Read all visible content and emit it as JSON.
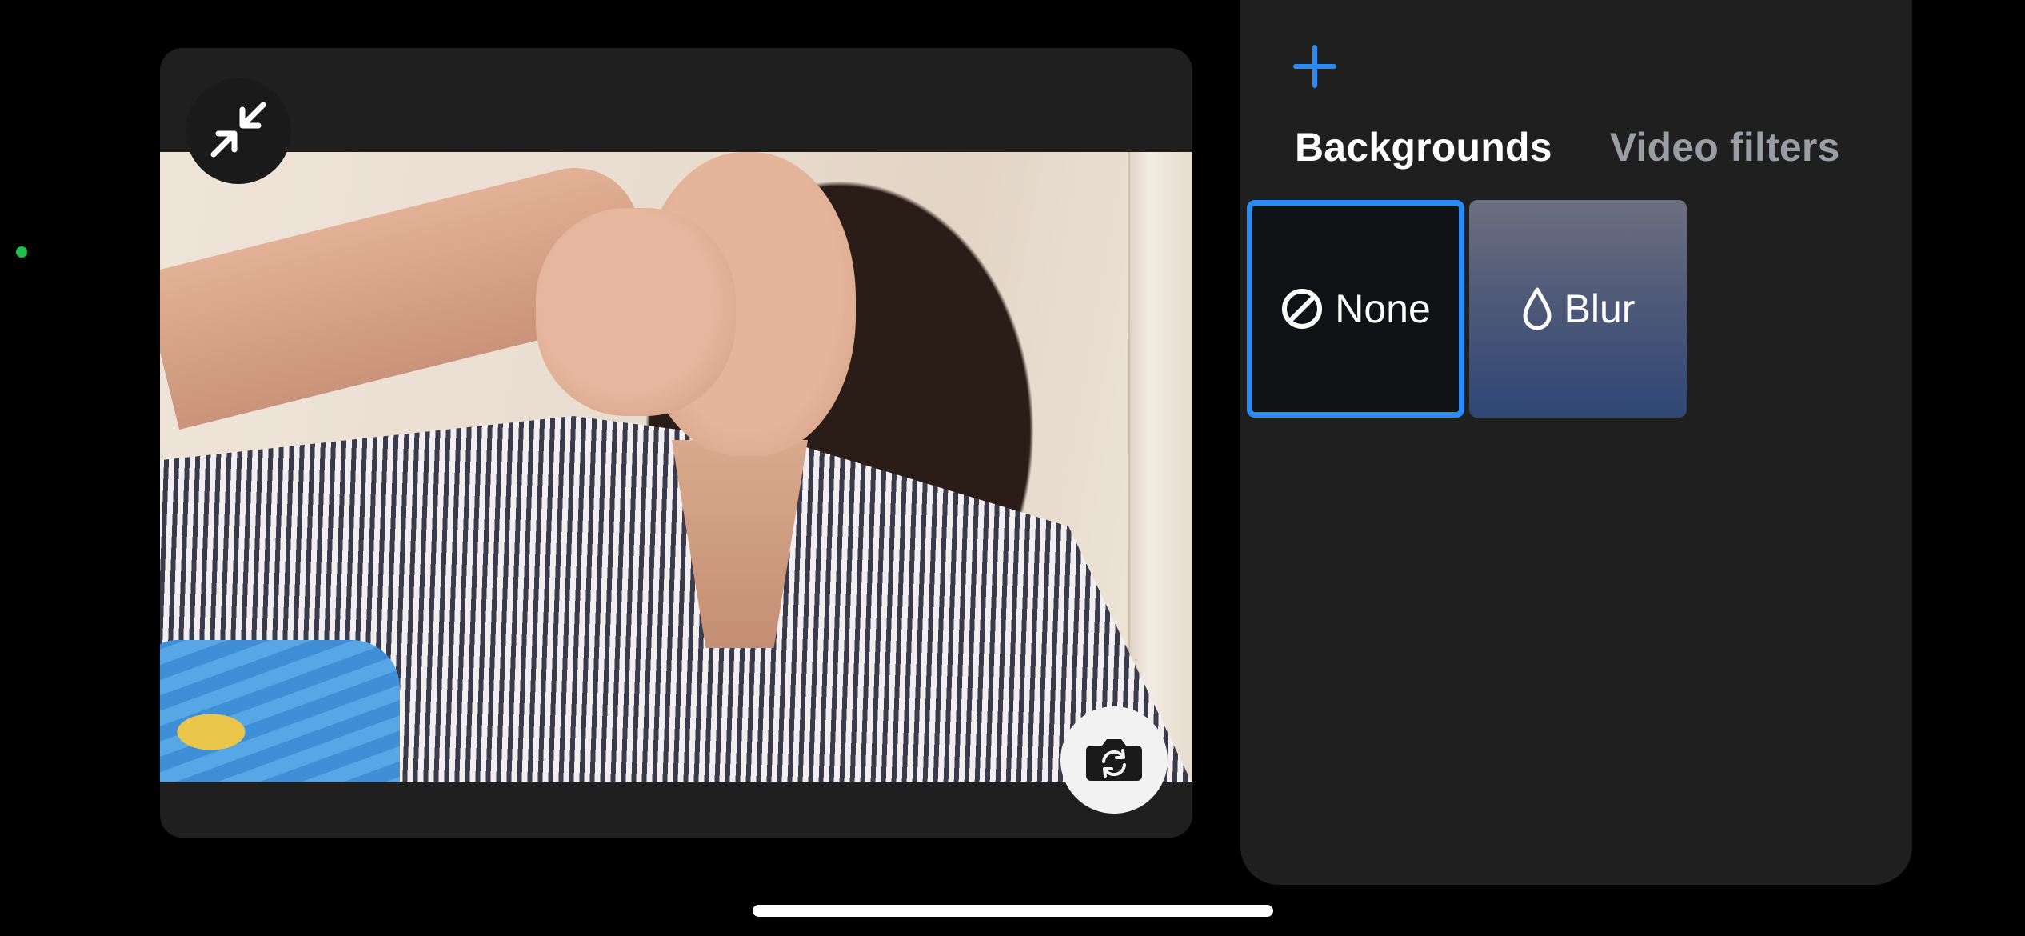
{
  "colors": {
    "background": "#000000",
    "panel": "#1f1f1f",
    "accent": "#2a8bf2",
    "status_dot": "#1fbf4a",
    "tab_inactive": "#9a9ea4"
  },
  "preview": {
    "collapse_icon": "collapse-arrows-icon",
    "flip_camera_icon": "camera-flip-icon",
    "video_feed": "self camera preview"
  },
  "panel": {
    "add_icon": "plus-icon",
    "tabs": [
      {
        "label": "Backgrounds",
        "active": true
      },
      {
        "label": "Video filters",
        "active": false
      }
    ],
    "options": [
      {
        "label": "None",
        "icon": "slash-circle-icon",
        "selected": true
      },
      {
        "label": "Blur",
        "icon": "droplet-icon",
        "selected": false
      }
    ]
  }
}
